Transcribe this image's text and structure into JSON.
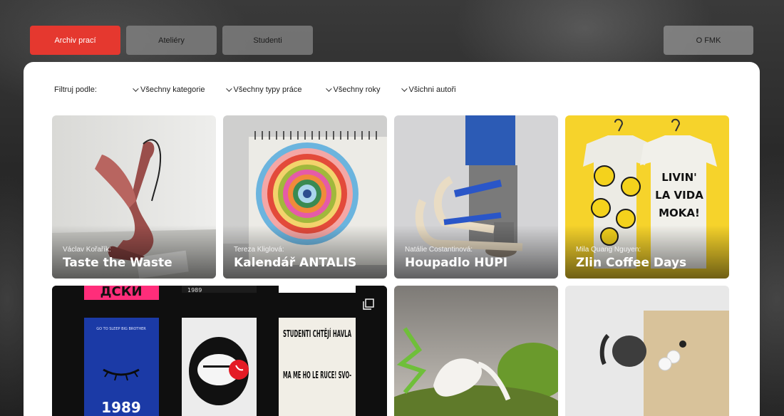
{
  "nav": {
    "items": [
      "Archiv prací",
      "Ateliéry",
      "Studenti"
    ],
    "right": "O FMK"
  },
  "filters": {
    "label": "Filtruj podle:",
    "options": [
      "Všechny kategorie",
      "Všechny typy práce",
      "Všechny roky",
      "Všichni autoři"
    ]
  },
  "cards": [
    {
      "author": "Václav Kořařík:",
      "title": "Taste the Waste"
    },
    {
      "author": "Tereza Kliglová:",
      "title": "Kalendář ANTALIS"
    },
    {
      "author": "Natálie Costantinová:",
      "title": "Houpadlo HUPI"
    },
    {
      "author": "Mila Quang Nguyen:",
      "title": "Zlin Coffee Days"
    }
  ],
  "posters": {
    "poster1_top": "ДСКЙ",
    "poster1_year": "1989",
    "poster1_small": "GO TO SLEEP BIG BROTHER",
    "poster2_year": "1989",
    "poster3_head": "STUDENTI CHTĚJÍ HAVLA",
    "poster3_body": "MA ME HO LE RUCE! SVO-"
  },
  "shirt": {
    "lines": [
      "LIVIN'",
      "LA VIDA",
      "MOKA!"
    ]
  }
}
